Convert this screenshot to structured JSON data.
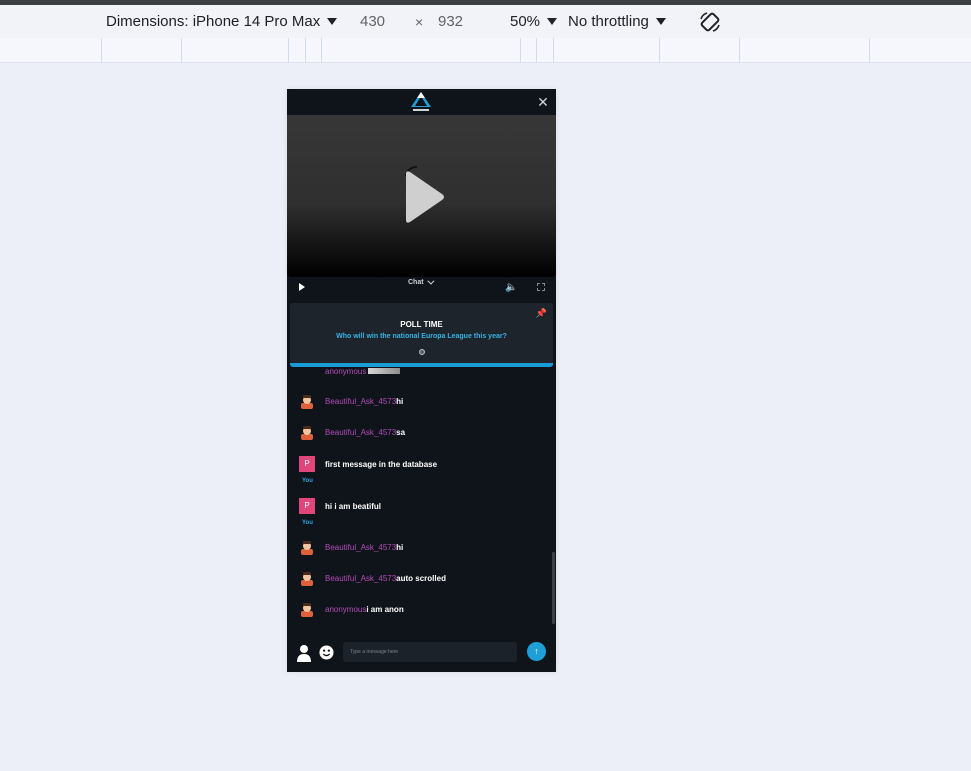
{
  "devtools": {
    "dimensions_label": "Dimensions: iPhone 14 Pro Max",
    "width": "430",
    "times": "×",
    "height": "932",
    "zoom": "50%",
    "throttling": "No throttling"
  },
  "app": {
    "logo_text": "SPORTS",
    "close_glyph": "✕"
  },
  "chat_toggle": "Chat",
  "poll": {
    "title": "POLL TIME",
    "question": "Who will win the national Europa League this year?"
  },
  "messages": [
    {
      "type": "other",
      "user": "anonymous",
      "text": ""
    },
    {
      "type": "other",
      "user": "Beautiful_Ask_4573",
      "text": "hi"
    },
    {
      "type": "other",
      "user": "Beautiful_Ask_4573",
      "text": "sa"
    },
    {
      "type": "self",
      "initial": "P",
      "label": "You",
      "text": "first message in the database"
    },
    {
      "type": "self",
      "initial": "P",
      "label": "You",
      "text": "hi i am beatiful"
    },
    {
      "type": "other",
      "user": "Beautiful_Ask_4573",
      "text": "hi"
    },
    {
      "type": "other",
      "user": "Beautiful_Ask_4573",
      "text": "auto scrolled"
    },
    {
      "type": "other",
      "user": "anonymous",
      "text": "i am anon"
    }
  ],
  "composer": {
    "placeholder": "Type a message here",
    "send_glyph": "↑"
  },
  "colors": {
    "accent": "#1e9fd8",
    "username": "#b44ab8",
    "self_avatar": "#e0467a"
  }
}
